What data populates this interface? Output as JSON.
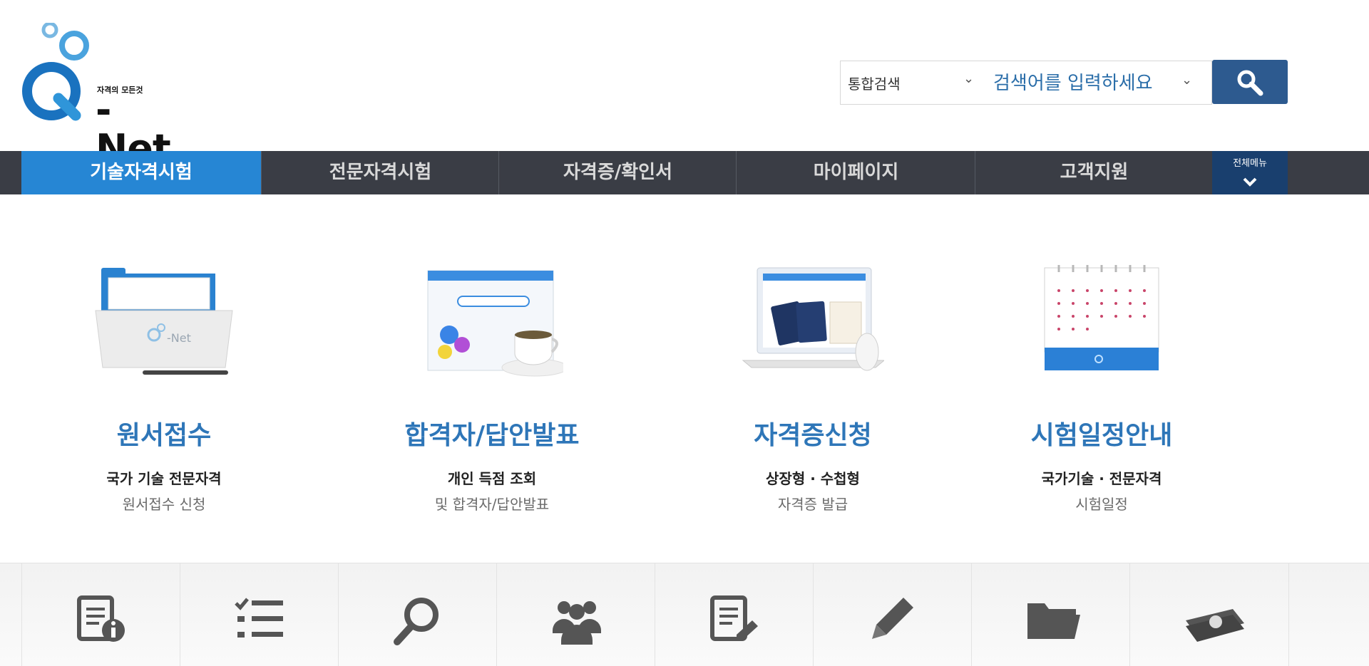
{
  "header": {
    "logo_tagline": "자격의 모든것",
    "logo_text": "-Net",
    "search": {
      "scope_label": "통합검색",
      "placeholder": "검색어를 입력하세요"
    }
  },
  "nav": {
    "items": [
      {
        "label": "기술자격시험"
      },
      {
        "label": "전문자격시험"
      },
      {
        "label": "자격증/확인서"
      },
      {
        "label": "마이페이지"
      },
      {
        "label": "고객지원"
      }
    ],
    "all_menu_label": "전체메뉴"
  },
  "cards": [
    {
      "title": "원서접수",
      "line1": "국가 기술 전문자격",
      "line2": "원서접수 신청",
      "illustration": "folder-illustration"
    },
    {
      "title": "합격자/답안발표",
      "line1": "개인 득점 조회",
      "line2": "및 합격자/답안발표",
      "illustration": "browser-tea-illustration"
    },
    {
      "title": "자격증신청",
      "line1": "상장형 · 수첩형",
      "line2": "자격증 발급",
      "illustration": "laptop-passport-illustration"
    },
    {
      "title": "시험일정안내",
      "line1": "국가기술 · 전문자격",
      "line2": "시험일정",
      "illustration": "calendar-illustration"
    }
  ],
  "quick_icons": [
    "document-info-icon",
    "checklist-icon",
    "search-icon",
    "group-icon",
    "document-edit-icon",
    "pencil-icon",
    "folder-icon",
    "money-icon"
  ],
  "colors": {
    "brand_blue": "#2e76b8",
    "nav_bg": "#3a3d45",
    "nav_active": "#2686d4",
    "search_button": "#2d5a8f",
    "all_menu_bg": "#193f6e"
  }
}
